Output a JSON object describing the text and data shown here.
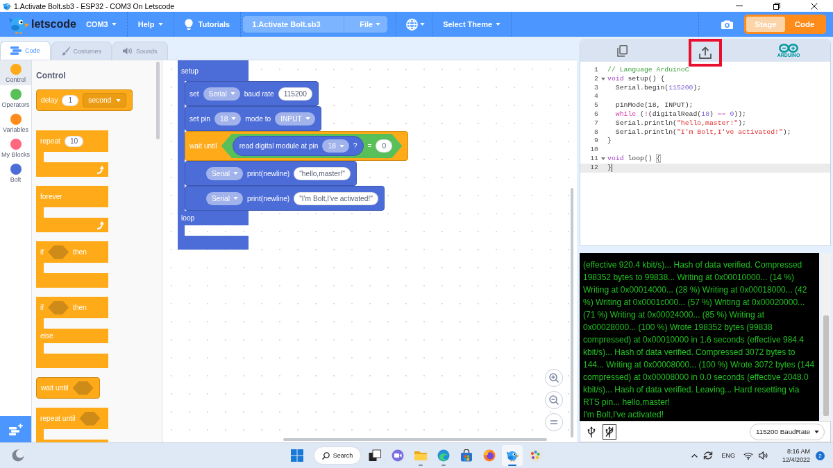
{
  "window": {
    "title": "1.Activate Bolt.sb3 - ESP32 - COM3 On Letscode"
  },
  "menu_bar": {
    "logo": "letscode",
    "items": [
      {
        "kind": "dropdown",
        "label": "COM3"
      },
      {
        "kind": "dropdown",
        "label": "Help"
      },
      {
        "kind": "tutorials",
        "label": "Tutorials"
      },
      {
        "kind": "project",
        "value": "1.Activate Bolt.sb3",
        "menu": "File"
      },
      {
        "kind": "language"
      },
      {
        "kind": "dropdown",
        "label": "Select Theme"
      }
    ],
    "view_toggle": [
      {
        "label": "Stage",
        "selected": false
      },
      {
        "label": "Code",
        "selected": true
      }
    ]
  },
  "editor_tabs": [
    {
      "kind": "code",
      "label": "Code",
      "selected": true
    },
    {
      "kind": "costumes",
      "label": "Costumes",
      "selected": false
    },
    {
      "kind": "sounds",
      "label": "Sounds",
      "selected": false
    }
  ],
  "categories": [
    {
      "name": "Control",
      "color": "#ffab19",
      "selected": true
    },
    {
      "name": "Operators",
      "color": "#59c059",
      "selected": false
    },
    {
      "name": "Variables",
      "color": "#ff8c1a",
      "selected": false
    },
    {
      "name": "My Blocks",
      "color": "#ff6680",
      "selected": false
    },
    {
      "name": "Bolt",
      "color": "#4c6cd8",
      "selected": false
    }
  ],
  "palette": {
    "heading": "Control",
    "blocks": [
      {
        "kind": "stack",
        "parts": [
          {
            "kind": "label",
            "text": "delay"
          },
          {
            "kind": "input",
            "text": "1"
          },
          {
            "kind": "menu",
            "text": "second"
          }
        ]
      },
      {
        "kind": "loop",
        "parts": [
          {
            "kind": "label",
            "text": "repeat"
          },
          {
            "kind": "input",
            "text": "10"
          }
        ]
      },
      {
        "kind": "loop",
        "parts": [
          {
            "kind": "label",
            "text": "forever"
          }
        ]
      },
      {
        "kind": "c",
        "parts": [
          {
            "kind": "label",
            "text": "if"
          },
          {
            "kind": "slot"
          },
          {
            "kind": "label",
            "text": "then"
          }
        ]
      },
      {
        "kind": "c-else",
        "parts": [
          {
            "kind": "label",
            "text": "if"
          },
          {
            "kind": "slot"
          },
          {
            "kind": "label",
            "text": "then"
          }
        ],
        "else": "else"
      },
      {
        "kind": "stack",
        "parts": [
          {
            "kind": "label",
            "text": "wait until"
          },
          {
            "kind": "slot"
          }
        ]
      },
      {
        "kind": "c",
        "parts": [
          {
            "kind": "label",
            "text": "repeat until"
          },
          {
            "kind": "slot"
          }
        ]
      }
    ]
  },
  "workspace": {
    "script": {
      "sections": [
        {
          "label": "setup",
          "blocks": [
            {
              "color": "#4c6cd8",
              "parts": [
                {
                  "kind": "label",
                  "text": "set"
                },
                {
                  "kind": "dropdown",
                  "text": "Serial"
                },
                {
                  "kind": "label",
                  "text": "baud rate"
                },
                {
                  "kind": "input",
                  "text": "115200"
                }
              ]
            },
            {
              "color": "#4c6cd8",
              "parts": [
                {
                  "kind": "label",
                  "text": "set pin"
                },
                {
                  "kind": "dropdown",
                  "text": "18"
                },
                {
                  "kind": "label",
                  "text": "mode to"
                },
                {
                  "kind": "dropdown",
                  "text": "INPUT"
                }
              ]
            },
            {
              "color": "#ffab19",
              "parts": [
                {
                  "kind": "label",
                  "text": "wait until"
                },
                {
                  "kind": "boolean",
                  "color": "#59c059",
                  "parts": [
                    {
                      "kind": "reporter",
                      "color": "#4c6cd8",
                      "parts": [
                        {
                          "kind": "label",
                          "text": "read digital module at pin"
                        },
                        {
                          "kind": "dropdown",
                          "text": "18"
                        },
                        {
                          "kind": "label",
                          "text": "?"
                        }
                      ]
                    },
                    {
                      "kind": "label",
                      "text": "="
                    },
                    {
                      "kind": "input",
                      "text": "0"
                    }
                  ]
                }
              ]
            },
            {
              "color": "#4c6cd8",
              "parts": [
                {
                  "kind": "dropdown",
                  "text": "Serial"
                },
                {
                  "kind": "label",
                  "text": "print(newline)"
                },
                {
                  "kind": "input",
                  "text": "\"hello,master!\""
                }
              ]
            },
            {
              "color": "#4c6cd8",
              "parts": [
                {
                  "kind": "dropdown",
                  "text": "Serial"
                },
                {
                  "kind": "label",
                  "text": "print(newline)"
                },
                {
                  "kind": "input",
                  "text": "\"I'm Bolt,I've activated!\""
                }
              ]
            }
          ]
        },
        {
          "label": "loop"
        }
      ]
    }
  },
  "code_panel": {
    "tools": [
      {
        "kind": "copy",
        "highlighted": false
      },
      {
        "kind": "upload",
        "highlighted": true
      },
      {
        "kind": "arduino",
        "label": "ARDUINO",
        "highlighted": false
      }
    ],
    "lines": [
      {
        "number": "1",
        "fold": false,
        "current": false,
        "tokens": [
          {
            "kind": "comment",
            "text": "// Language ArduinoC"
          }
        ]
      },
      {
        "number": "2",
        "fold": true,
        "current": false,
        "tokens": [
          {
            "kind": "type",
            "text": "void"
          },
          {
            "kind": "plain",
            "text": " setup() {"
          }
        ]
      },
      {
        "number": "3",
        "fold": false,
        "current": false,
        "tokens": [
          {
            "kind": "plain",
            "text": "  Serial.begin("
          },
          {
            "kind": "number",
            "text": "115200"
          },
          {
            "kind": "plain",
            "text": ");"
          }
        ]
      },
      {
        "number": "4",
        "fold": false,
        "current": false
      },
      {
        "number": "5",
        "fold": false,
        "current": false,
        "tokens": [
          {
            "kind": "plain",
            "text": "  pinMode(18, INPUT);"
          }
        ]
      },
      {
        "number": "6",
        "fold": false,
        "current": false,
        "tokens": [
          {
            "kind": "keyword",
            "text": "  while"
          },
          {
            "kind": "plain",
            "text": " ("
          },
          {
            "kind": "keyword",
            "text": "!"
          },
          {
            "kind": "plain",
            "text": "(digitalRead("
          },
          {
            "kind": "number",
            "text": "18"
          },
          {
            "kind": "plain",
            "text": ") "
          },
          {
            "kind": "keyword",
            "text": "=="
          },
          {
            "kind": "number",
            "text": " 0"
          },
          {
            "kind": "plain",
            "text": "));"
          }
        ]
      },
      {
        "number": "7",
        "fold": false,
        "current": false,
        "tokens": [
          {
            "kind": "plain",
            "text": "  Serial.println("
          },
          {
            "kind": "string",
            "text": "\"hello,master!\""
          },
          {
            "kind": "plain",
            "text": ");"
          }
        ]
      },
      {
        "number": "8",
        "fold": false,
        "current": false,
        "tokens": [
          {
            "kind": "plain",
            "text": "  Serial.println("
          },
          {
            "kind": "string",
            "text": "\"I'm Bolt,I've activated!\""
          },
          {
            "kind": "plain",
            "text": ");"
          }
        ]
      },
      {
        "number": "9",
        "fold": false,
        "current": false,
        "tokens": [
          {
            "kind": "plain",
            "text": "}"
          }
        ]
      },
      {
        "number": "10",
        "fold": false,
        "current": false
      },
      {
        "number": "11",
        "fold": true,
        "current": false,
        "tokens": [
          {
            "kind": "type",
            "text": "void"
          },
          {
            "kind": "plain",
            "text": " loop() "
          },
          {
            "kind": "match",
            "text": "{"
          }
        ]
      },
      {
        "number": "12",
        "fold": false,
        "current": true,
        "tokens": [
          {
            "kind": "plain",
            "text": "}"
          }
        ]
      }
    ]
  },
  "console": {
    "lines": [
      "(effective 920.4 kbit/s)... Hash of data verified. Compressed",
      "198352 bytes to 99838... Writing at 0x00010000... (14 %)",
      "Writing at 0x00014000... (28 %) Writing at 0x00018000... (42",
      "%) Writing at 0x0001c000... (57 %) Writing at 0x00020000...",
      "(71 %) Writing at 0x00024000... (85 %) Writing at",
      "0x00028000... (100 %) Wrote 198352 bytes (99838",
      "compressed) at 0x00010000 in 1.6 seconds (effective 984.4",
      "kbit/s)... Hash of data verified. Compressed 3072 bytes to",
      "144... Writing at 0x00008000... (100 %) Wrote 3072 bytes (144",
      "compressed) at 0x00008000 in 0.0 seconds (effective 2048.0",
      "kbit/s)... Hash of data verified. Leaving... Hard resetting via",
      "RTS pin... hello,master!",
      "I'm Bolt,I've activated!"
    ]
  },
  "serial_bar": {
    "ports": [
      {
        "kind": "usb",
        "selected": false
      },
      {
        "kind": "usb-off",
        "selected": true
      }
    ],
    "baud": "115200 BaudRate"
  },
  "taskbar": {
    "search": "Search",
    "apps": [
      {
        "kind": "task-view",
        "selected": false,
        "running": false
      },
      {
        "kind": "chat",
        "selected": false,
        "running": false
      },
      {
        "kind": "files",
        "selected": false,
        "running": true
      },
      {
        "kind": "browser",
        "selected": false,
        "running": true
      },
      {
        "kind": "store",
        "selected": false,
        "running": false
      },
      {
        "kind": "fox-browser",
        "selected": false,
        "running": false
      },
      {
        "kind": "bird-app",
        "selected": true,
        "running": true
      },
      {
        "kind": "paint",
        "selected": false,
        "running": false
      }
    ],
    "language": "ENG",
    "time": "8:16 AM",
    "date": "12/4/2022",
    "notifications": "2"
  }
}
